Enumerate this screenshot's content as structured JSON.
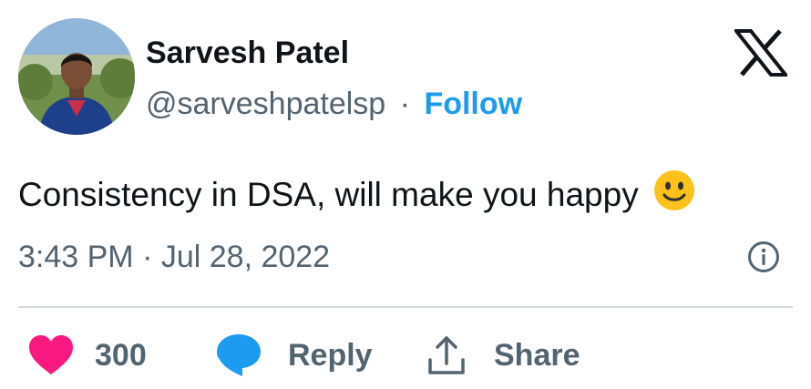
{
  "author": {
    "display_name": "Sarvesh Patel",
    "handle": "@sarveshpatelsp",
    "separator": "·",
    "follow_label": "Follow"
  },
  "tweet": {
    "text": "Consistency in DSA, will make you happy",
    "emoji": "slightly-smiling-face",
    "timestamp": "3:43 PM · Jul 28, 2022"
  },
  "actions": {
    "like_count": "300",
    "reply_label": "Reply",
    "share_label": "Share"
  },
  "icons": {
    "logo": "x-logo-icon",
    "info": "info-icon",
    "like": "heart-icon",
    "reply": "speech-bubble-icon",
    "share": "share-upload-icon"
  },
  "colors": {
    "link": "#1d9bf0",
    "heart": "#f91880",
    "reply_bubble": "#1d9bf0",
    "secondary_text": "#536471",
    "emoji_face": "#fcc21b"
  }
}
